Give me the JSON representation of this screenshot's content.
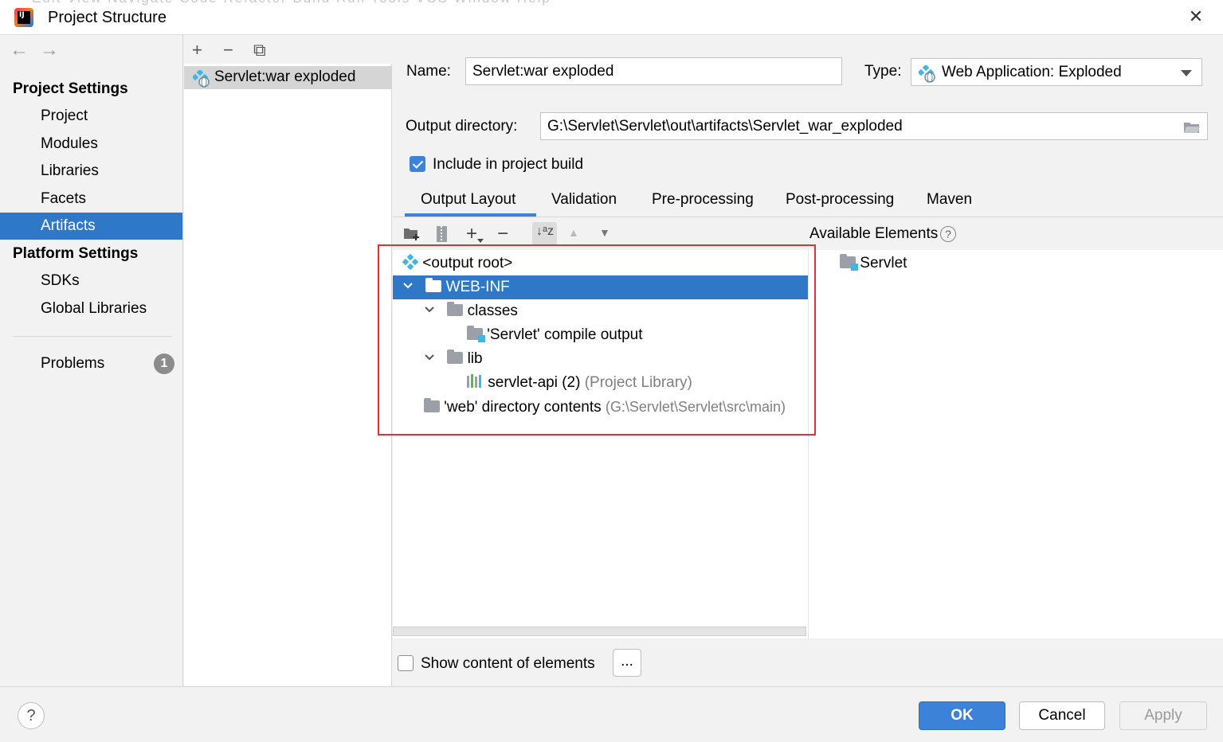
{
  "window": {
    "menu_ghost": "Edit   View   Navigate   Code   Refactor   Build   Run   Tools   VCS   Window   Help",
    "title": "Project Structure",
    "close_glyph": "✕"
  },
  "nav": {
    "back": "←",
    "forward": "→"
  },
  "sidebar": {
    "project_settings_heading": "Project Settings",
    "project_items": [
      {
        "label": "Project"
      },
      {
        "label": "Modules"
      },
      {
        "label": "Libraries"
      },
      {
        "label": "Facets"
      },
      {
        "label": "Artifacts",
        "selected": true
      }
    ],
    "platform_settings_heading": "Platform Settings",
    "platform_items": [
      {
        "label": "SDKs"
      },
      {
        "label": "Global Libraries"
      }
    ],
    "problems_label": "Problems",
    "problems_count": "1"
  },
  "artifacts_list": {
    "toolbar": {
      "add": "+",
      "remove": "−",
      "copy": "⧉"
    },
    "items": [
      {
        "label": "Servlet:war exploded",
        "selected": true
      }
    ]
  },
  "form": {
    "name_label": "Name:",
    "name_value": "Servlet:war exploded",
    "type_label": "Type:",
    "type_value": "Web Application: Exploded",
    "output_dir_label": "Output directory:",
    "output_dir_value": "G:\\Servlet\\Servlet\\out\\artifacts\\Servlet_war_exploded",
    "include_build_label": "Include in project build",
    "include_build_checked": true
  },
  "tabs": [
    {
      "label": "Output Layout",
      "active": true
    },
    {
      "label": "Validation"
    },
    {
      "label": "Pre-processing"
    },
    {
      "label": "Post-processing"
    },
    {
      "label": "Maven"
    }
  ],
  "layout_toolbar": {
    "add": "+",
    "remove": "−",
    "up": "▲",
    "down": "▼",
    "sort": "↓ᵃz"
  },
  "tree": {
    "root": "<output root>",
    "web_inf": "WEB-INF",
    "classes": "classes",
    "compile_output": "'Servlet' compile output",
    "lib": "lib",
    "servlet_api": "servlet-api (2)",
    "servlet_api_hint": "(Project Library)",
    "web_contents": "'web' directory contents",
    "web_contents_hint": "(G:\\Servlet\\Servlet\\src\\main)"
  },
  "available": {
    "heading": "Available Elements",
    "help_glyph": "?",
    "items": [
      {
        "label": "Servlet"
      }
    ]
  },
  "show_content_label": "Show content of elements",
  "dots_label": "...",
  "buttons": {
    "ok": "OK",
    "cancel": "Cancel",
    "apply": "Apply",
    "help": "?"
  },
  "colors": {
    "accent": "#3d82d9",
    "selection": "#2f78c8",
    "highlight_box": "#e0303a"
  }
}
